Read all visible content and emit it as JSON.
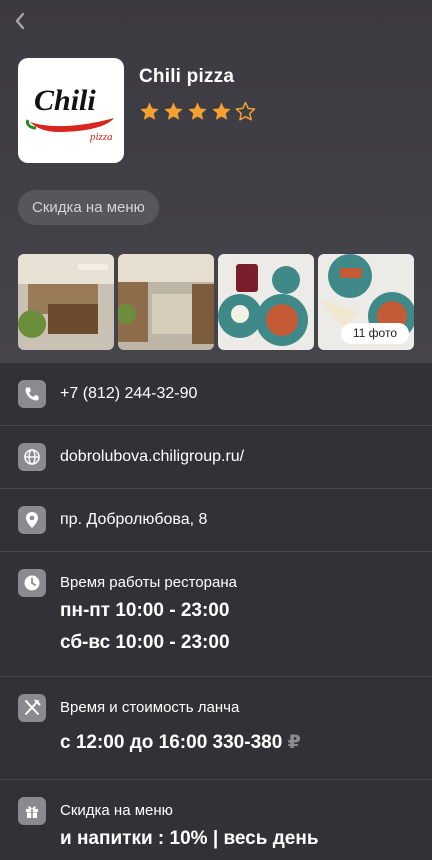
{
  "nav": {
    "back_icon": "chevron-left-icon"
  },
  "restaurant": {
    "name": "Chili pizza",
    "logo_text": "Chili",
    "logo_subtext": "pizza",
    "rating": 4,
    "rating_max": 5,
    "star_color": "#f5a032"
  },
  "chip_label": "Скидка на меню",
  "photos": {
    "count_label": "11 фото"
  },
  "contacts": {
    "phone": "+7 (812) 244-32-90",
    "website": "dobrolubova.chiligroup.ru/",
    "address": "пр. Добролюбова, 8"
  },
  "hours": {
    "label": "Время работы ресторана",
    "weekdays": "пн-пт 10:00 - 23:00",
    "weekend": "сб-вс 10:00 - 23:00"
  },
  "lunch": {
    "label": "Время и стоимость ланча",
    "value": "с 12:00 до 16:00 330-380",
    "currency": "₽"
  },
  "discount": {
    "label": "Скидка на меню",
    "value": "и напитки : 10% | весь день"
  }
}
